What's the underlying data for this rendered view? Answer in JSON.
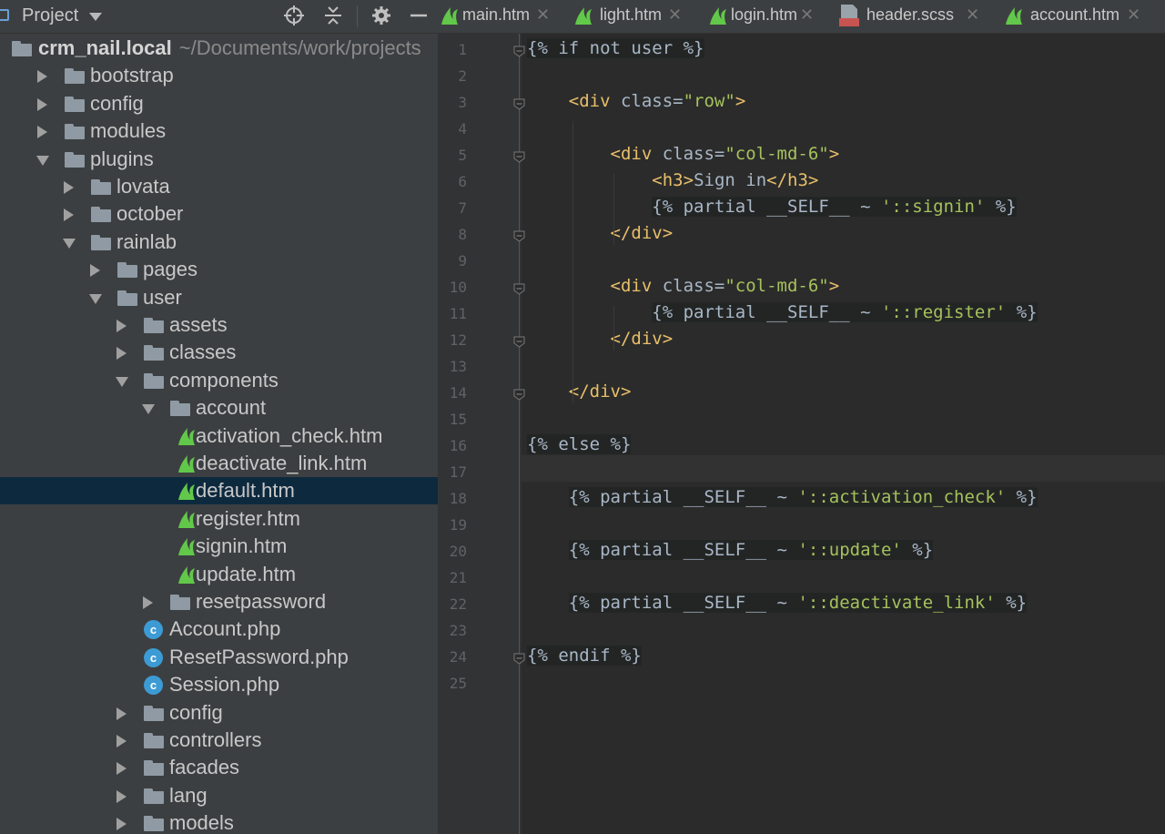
{
  "sidebar": {
    "header": {
      "label": "Project"
    },
    "tree": [
      {
        "label": "crm_nail.local",
        "path": "~/Documents/work/projects",
        "type": "root"
      },
      {
        "label": "bootstrap",
        "type": "folder",
        "expanded": false
      },
      {
        "label": "config",
        "type": "folder",
        "expanded": false
      },
      {
        "label": "modules",
        "type": "folder",
        "expanded": false
      },
      {
        "label": "plugins",
        "type": "folder",
        "expanded": true
      },
      {
        "label": "lovata",
        "type": "folder",
        "expanded": false
      },
      {
        "label": "october",
        "type": "folder",
        "expanded": false
      },
      {
        "label": "rainlab",
        "type": "folder",
        "expanded": true
      },
      {
        "label": "pages",
        "type": "folder",
        "expanded": false
      },
      {
        "label": "user",
        "type": "folder",
        "expanded": true
      },
      {
        "label": "assets",
        "type": "folder",
        "expanded": false
      },
      {
        "label": "classes",
        "type": "folder",
        "expanded": false
      },
      {
        "label": "components",
        "type": "folder",
        "expanded": true
      },
      {
        "label": "account",
        "type": "folder",
        "expanded": true
      },
      {
        "label": "activation_check.htm",
        "type": "twig"
      },
      {
        "label": "deactivate_link.htm",
        "type": "twig"
      },
      {
        "label": "default.htm",
        "type": "twig",
        "selected": true
      },
      {
        "label": "register.htm",
        "type": "twig"
      },
      {
        "label": "signin.htm",
        "type": "twig"
      },
      {
        "label": "update.htm",
        "type": "twig"
      },
      {
        "label": "resetpassword",
        "type": "folder",
        "expanded": false
      },
      {
        "label": "Account.php",
        "type": "class"
      },
      {
        "label": "ResetPassword.php",
        "type": "class"
      },
      {
        "label": "Session.php",
        "type": "class"
      },
      {
        "label": "config",
        "type": "folder",
        "expanded": false
      },
      {
        "label": "controllers",
        "type": "folder",
        "expanded": false
      },
      {
        "label": "facades",
        "type": "folder",
        "expanded": false
      },
      {
        "label": "lang",
        "type": "folder",
        "expanded": false
      },
      {
        "label": "models",
        "type": "folder",
        "expanded": false
      }
    ]
  },
  "tabs": [
    {
      "label": "main.htm",
      "icon": "twig-leaf-icon"
    },
    {
      "label": "light.htm",
      "icon": "twig-leaf-icon"
    },
    {
      "label": "login.htm",
      "icon": "twig-leaf-icon"
    },
    {
      "label": "header.scss",
      "icon": "sass-file-icon"
    },
    {
      "label": "account.htm",
      "icon": "twig-leaf-icon"
    }
  ],
  "editor": {
    "current_line": 17,
    "lines": [
      "{% if not user %}",
      "",
      "    <div class=\"row\">",
      "",
      "        <div class=\"col-md-6\">",
      "            <h3>Sign in</h3>",
      "            {% partial __SELF__ ~ '::signin' %}",
      "        </div>",
      "",
      "        <div class=\"col-md-6\">",
      "            {% partial __SELF__ ~ '::register' %}",
      "        </div>",
      "",
      "    </div>",
      "",
      "{% else %}",
      "",
      "    {% partial __SELF__ ~ '::activation_check' %}",
      "",
      "    {% partial __SELF__ ~ '::update' %}",
      "",
      "    {% partial __SELF__ ~ '::deactivate_link' %}",
      "",
      "{% endif %}",
      ""
    ]
  },
  "colors": {
    "sidebar_bg": "#3c3f41",
    "editor_bg": "#2b2b2b",
    "selection_bg": "#0d293e",
    "keyword": "#cc7832",
    "tag": "#e8bf6a",
    "string": "#a5c25c",
    "twig_leaf": "#62c84a",
    "class_icon": "#3c9bd4"
  }
}
